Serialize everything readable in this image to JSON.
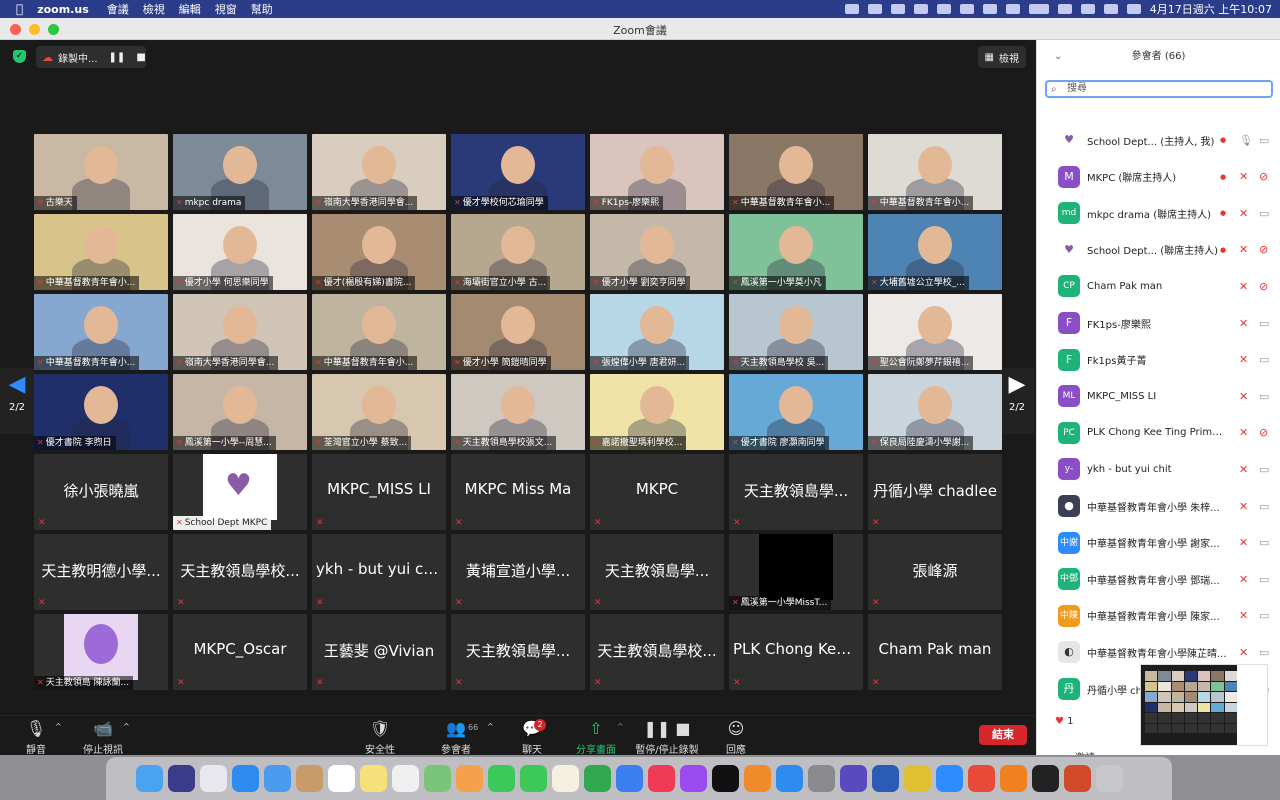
{
  "menubar": {
    "app": "zoom.us",
    "menus": [
      "會議",
      "檢視",
      "編輯",
      "視窗",
      "幫助"
    ],
    "clock": "4月17日週六 上午10:07"
  },
  "window": {
    "title": "Zoom會議"
  },
  "topbar": {
    "recording_label": "錄製中...",
    "view_label": "檢視"
  },
  "paging": {
    "left": "2/2",
    "right": "2/2"
  },
  "video_tiles": [
    {
      "name": "古樂天",
      "bg": "#c9b9a4"
    },
    {
      "name": "mkpc drama",
      "bg": "#7d8b98"
    },
    {
      "name": "嶺南大學香港同學會...",
      "bg": "#d8cdbf"
    },
    {
      "name": "優才學校何芯瑜同學",
      "bg": "#2a3a78"
    },
    {
      "name": "FK1ps-廖樂熙",
      "bg": "#d9c4be"
    },
    {
      "name": "中華基督教青年會小...",
      "bg": "#8a7766"
    },
    {
      "name": "中華基督教青年會小...",
      "bg": "#dedad4"
    },
    {
      "name": "中華基督教青年會小...",
      "bg": "#d8c48a"
    },
    {
      "name": "優才小學 何思樂同學",
      "bg": "#eae4de"
    },
    {
      "name": "優才(楊殷有娣)書院...",
      "bg": "#a98d73"
    },
    {
      "name": "海壩街官立小學 古...",
      "bg": "#b6a78f"
    },
    {
      "name": "優才小學 劉奕亨同學",
      "bg": "#c4b9a9"
    },
    {
      "name": "鳳溪第一小學莫小凡",
      "bg": "#7fc29a"
    },
    {
      "name": "大埔舊墟公立學校_...",
      "bg": "#4d84b4"
    },
    {
      "name": "中華基督教青年會小...",
      "bg": "#86a7cf"
    },
    {
      "name": "嶺南大學香港同學會...",
      "bg": "#cfc4b6"
    },
    {
      "name": "中華基督教青年會小...",
      "bg": "#bfb59e"
    },
    {
      "name": "優才小學 簡鎧晴同學",
      "bg": "#a58a72"
    },
    {
      "name": "張煌偉小學 唐君妍...",
      "bg": "#b7d6e6"
    },
    {
      "name": "天主教領島學校 吳...",
      "bg": "#b8c6cf"
    },
    {
      "name": "聖公會阮鄭夢芹銀禧...",
      "bg": "#ece9e6"
    },
    {
      "name": "優才書院 李煦日",
      "bg": "#1f2f6a"
    },
    {
      "name": "鳳溪第一小學--周慧...",
      "bg": "#c5b6a6"
    },
    {
      "name": "荃灣官立小學 蔡致...",
      "bg": "#d6c7ae"
    },
    {
      "name": "天主教領島學校張文...",
      "bg": "#cfc8c0"
    },
    {
      "name": "嘉諾撒聖瑪利學校...",
      "bg": "#efe3a8"
    },
    {
      "name": "優才書院 廖灝南同學",
      "bg": "#66a8d6"
    },
    {
      "name": "保良局陸慶濤小學謝...",
      "bg": "#c9d4dc"
    }
  ],
  "name_tiles": [
    {
      "name": "徐小張曉嵐",
      "caption": ""
    },
    {
      "name": "",
      "caption": "School Dept MKPC"
    },
    {
      "name": "MKPC_MISS LI",
      "caption": ""
    },
    {
      "name": "MKPC Miss Ma",
      "caption": ""
    },
    {
      "name": "MKPC",
      "caption": ""
    },
    {
      "name": "天主教領島學...",
      "caption": ""
    },
    {
      "name": "丹循小學 chadlee",
      "caption": ""
    },
    {
      "name": "天主教明德小學...",
      "caption": ""
    },
    {
      "name": "天主教領島學校...",
      "caption": ""
    },
    {
      "name": "ykh - but yui chit",
      "caption": ""
    },
    {
      "name": "黃埔宣道小學...",
      "caption": ""
    },
    {
      "name": "天主教領島學...",
      "caption": ""
    },
    {
      "name": "",
      "caption": "鳳溪第一小學MissT..."
    },
    {
      "name": "張峰源",
      "caption": ""
    },
    {
      "name": "",
      "caption": "天主教領島 陳詠蘭..."
    },
    {
      "name": "MKPC_Oscar",
      "caption": ""
    },
    {
      "name": "王藝斐 @Vivian",
      "caption": ""
    },
    {
      "name": "天主教領島學...",
      "caption": ""
    },
    {
      "name": "天主教領島學校...",
      "caption": ""
    },
    {
      "name": "PLK Chong Kee...",
      "caption": ""
    },
    {
      "name": "Cham Pak man",
      "caption": ""
    }
  ],
  "toolbar": {
    "mute": "靜音",
    "stop_video": "停止視訊",
    "security": "安全性",
    "participants": "參會者",
    "participants_count": "66",
    "chat": "聊天",
    "chat_badge": "2",
    "share": "分享畫面",
    "pause_record": "暫停/停止錄製",
    "reactions": "回應",
    "end": "結束"
  },
  "panel": {
    "title": "參會者 (66)",
    "search_placeholder": "搜尋",
    "reaction_count": "1",
    "invite": "邀請",
    "participants": [
      {
        "name": "School Dept... (主持人, 我)",
        "avatar": "♥",
        "color": "#ffffff",
        "fg": "#8a5ca8",
        "rec": true,
        "mic_ok": true,
        "cam_ok": true
      },
      {
        "name": "MKPC (聯席主持人)",
        "avatar": "M",
        "color": "#8a4fc6",
        "fg": "#ffffff",
        "rec": true,
        "mic_ok": false,
        "cam_ok": false
      },
      {
        "name": "mkpc drama (聯席主持人)",
        "avatar": "md",
        "color": "#1fb37a",
        "fg": "#ffffff",
        "rec": true,
        "mic_ok": false,
        "cam_ok": true
      },
      {
        "name": "School Dept... (聯席主持人)",
        "avatar": "♥",
        "color": "#ffffff",
        "fg": "#8a5ca8",
        "rec": true,
        "mic_ok": false,
        "cam_ok": false
      },
      {
        "name": "Cham Pak man",
        "avatar": "CP",
        "color": "#1fb37a",
        "fg": "#ffffff",
        "rec": false,
        "mic_ok": false,
        "cam_ok": false
      },
      {
        "name": "FK1ps-廖樂熙",
        "avatar": "F",
        "color": "#8a4fc6",
        "fg": "#ffffff",
        "rec": false,
        "mic_ok": false,
        "cam_ok": true
      },
      {
        "name": "Fk1ps黃子菁",
        "avatar": "F",
        "color": "#1fb37a",
        "fg": "#ffffff",
        "rec": false,
        "mic_ok": false,
        "cam_ok": true
      },
      {
        "name": "MKPC_MISS LI",
        "avatar": "ML",
        "color": "#8a4fc6",
        "fg": "#ffffff",
        "rec": false,
        "mic_ok": false,
        "cam_ok": true
      },
      {
        "name": "PLK Chong Kee Ting Primary...",
        "avatar": "PC",
        "color": "#1fb37a",
        "fg": "#ffffff",
        "rec": false,
        "mic_ok": false,
        "cam_ok": false
      },
      {
        "name": "ykh - but yui chit",
        "avatar": "y-",
        "color": "#8a4fc6",
        "fg": "#ffffff",
        "rec": false,
        "mic_ok": false,
        "cam_ok": true
      },
      {
        "name": "中華基督教青年會小學 朱梓...",
        "avatar": "●",
        "color": "#3a3f55",
        "fg": "#ffffff",
        "rec": false,
        "mic_ok": false,
        "cam_ok": true
      },
      {
        "name": "中華基督教青年會小學 謝家...",
        "avatar": "中謝",
        "color": "#2d8cff",
        "fg": "#ffffff",
        "rec": false,
        "mic_ok": false,
        "cam_ok": true
      },
      {
        "name": "中華基督教青年會小學 鄧瑞...",
        "avatar": "中鄧",
        "color": "#1fb37a",
        "fg": "#ffffff",
        "rec": false,
        "mic_ok": false,
        "cam_ok": true
      },
      {
        "name": "中華基督教青年會小學 陳家...",
        "avatar": "中陳",
        "color": "#f29a1a",
        "fg": "#ffffff",
        "rec": false,
        "mic_ok": false,
        "cam_ok": true
      },
      {
        "name": "中華基督教青年會小學陳芷晴...",
        "avatar": "◐",
        "color": "#e6e6e6",
        "fg": "#333333",
        "rec": false,
        "mic_ok": false,
        "cam_ok": true
      },
      {
        "name": "丹循小學 ch",
        "avatar": "丹",
        "color": "#1fb37a",
        "fg": "#ffffff",
        "rec": false,
        "mic_ok": false,
        "cam_ok": true
      }
    ]
  },
  "dock_apps": [
    "finder",
    "siri",
    "launchpad",
    "safari",
    "mail",
    "contacts",
    "calendar",
    "notes",
    "reminders",
    "maps",
    "photos",
    "messages",
    "facetime",
    "freeform",
    "numbers",
    "keynote",
    "music",
    "podcasts",
    "tv",
    "books",
    "appstore",
    "settings",
    "zoom-notes",
    "word",
    "vmix",
    "zoom",
    "chrome",
    "vlc",
    "piano",
    "powerpoint",
    "trash"
  ],
  "dock_colors": [
    "#4aa3f0",
    "#3b3b8c",
    "#e8e8ee",
    "#2e8cf0",
    "#4a9af0",
    "#c79b6a",
    "#ffffff",
    "#f5e07a",
    "#f0f0f0",
    "#7ac47a",
    "#f5a04a",
    "#3cc95a",
    "#3cc95a",
    "#f5f0e0",
    "#2fa84f",
    "#3a7ef0",
    "#f03a55",
    "#9a4af0",
    "#111111",
    "#f08a2a",
    "#2e8cf0",
    "#8a8a8e",
    "#5a4ac0",
    "#2b5bb5",
    "#e0c030",
    "#2d8cff",
    "#e84a3a",
    "#f08020",
    "#222222",
    "#d24a2a",
    "#c8c8cc"
  ]
}
